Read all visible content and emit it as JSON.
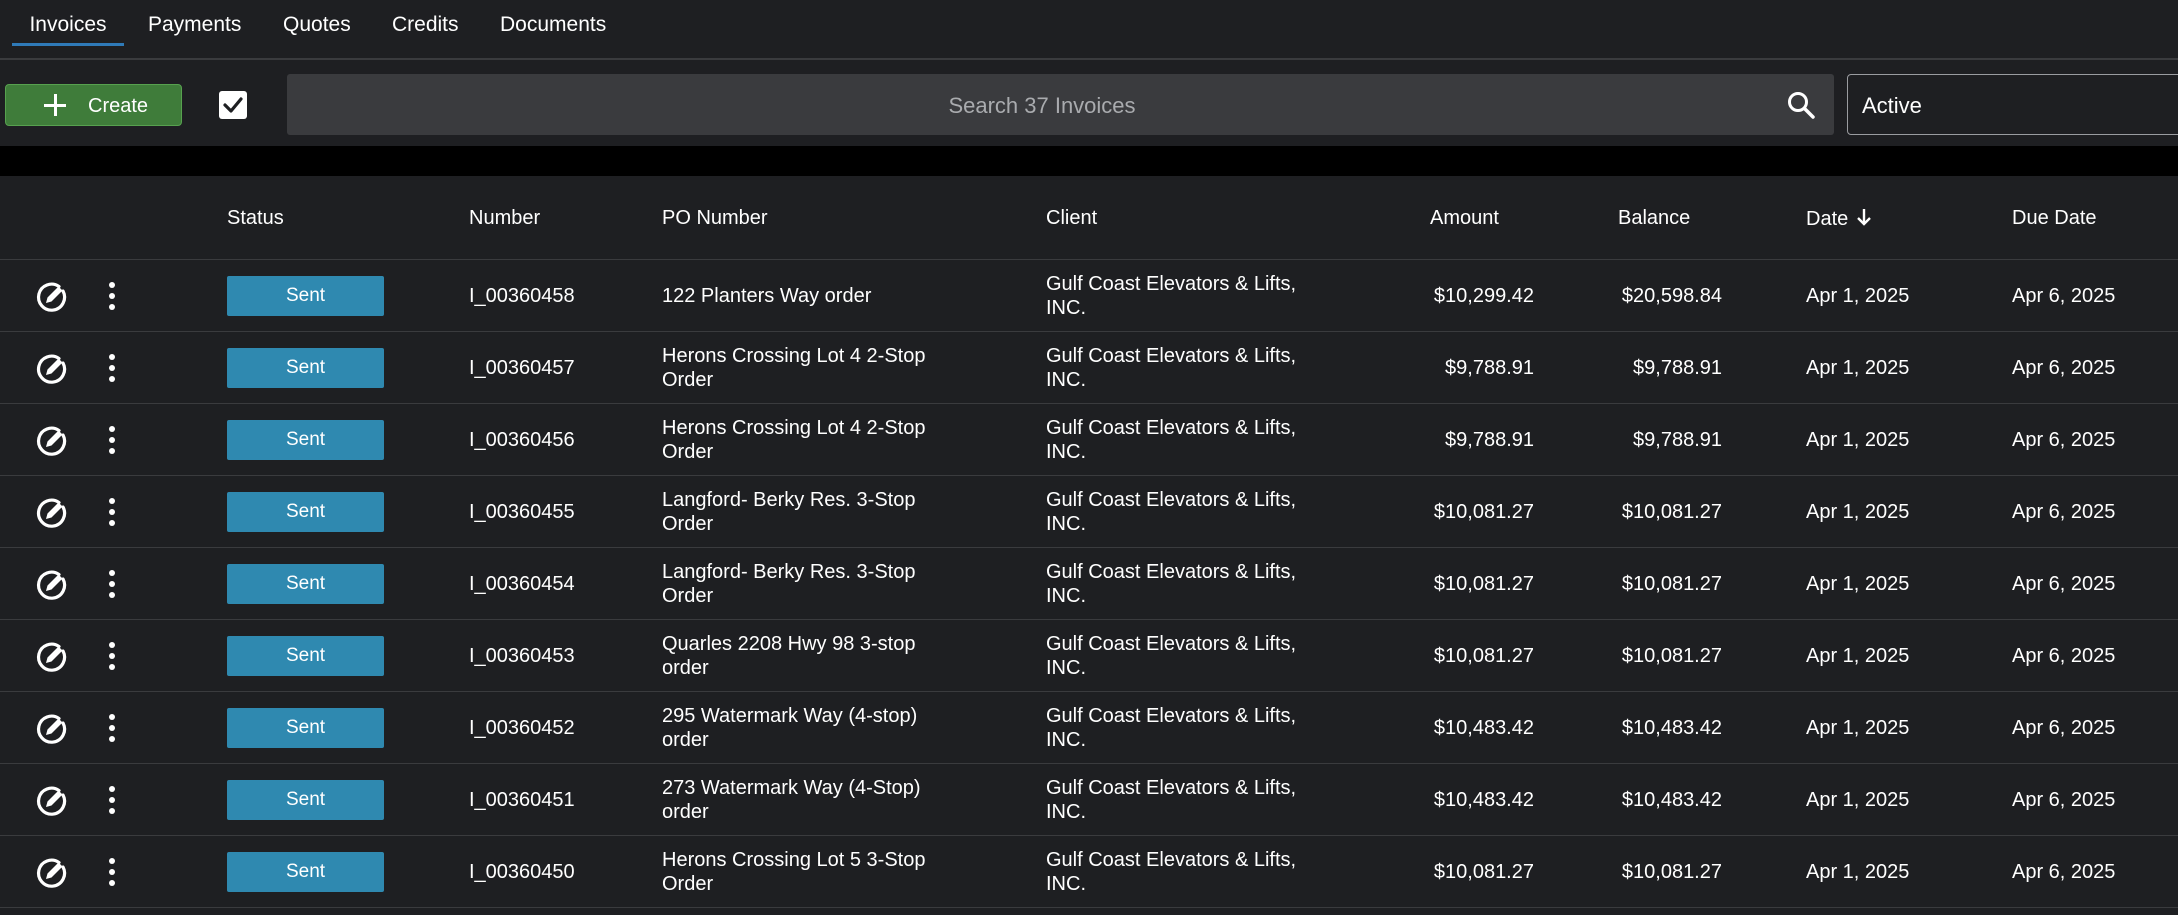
{
  "tabs": [
    {
      "label": "Invoices",
      "active": true
    },
    {
      "label": "Payments",
      "active": false
    },
    {
      "label": "Quotes",
      "active": false
    },
    {
      "label": "Credits",
      "active": false
    },
    {
      "label": "Documents",
      "active": false
    }
  ],
  "toolbar": {
    "create_label": "Create",
    "search_placeholder": "Search 37 Invoices",
    "status_filter": "Active"
  },
  "table": {
    "headers": {
      "status": "Status",
      "number": "Number",
      "po_number": "PO Number",
      "client": "Client",
      "amount": "Amount",
      "balance": "Balance",
      "date": "Date",
      "due_date": "Due Date"
    },
    "sort_indicator": "down-arrow",
    "rows": [
      {
        "status": "Sent",
        "number": "I_00360458",
        "po_line1": "122 Planters Way order",
        "po_line2": "",
        "client_line1": "Gulf Coast Elevators & Lifts,",
        "client_line2": "INC.",
        "amount": "$10,299.42",
        "balance": "$20,598.84",
        "date": "Apr 1, 2025",
        "due_date": "Apr 6, 2025"
      },
      {
        "status": "Sent",
        "number": "I_00360457",
        "po_line1": "Herons Crossing Lot 4  2-Stop",
        "po_line2": "Order",
        "client_line1": "Gulf Coast Elevators & Lifts,",
        "client_line2": "INC.",
        "amount": "$9,788.91",
        "balance": "$9,788.91",
        "date": "Apr 1, 2025",
        "due_date": "Apr 6, 2025"
      },
      {
        "status": "Sent",
        "number": "I_00360456",
        "po_line1": "Herons Crossing Lot 4  2-Stop",
        "po_line2": "Order",
        "client_line1": "Gulf Coast Elevators & Lifts,",
        "client_line2": "INC.",
        "amount": "$9,788.91",
        "balance": "$9,788.91",
        "date": "Apr 1, 2025",
        "due_date": "Apr 6, 2025"
      },
      {
        "status": "Sent",
        "number": "I_00360455",
        "po_line1": "Langford- Berky Res. 3-Stop",
        "po_line2": "Order",
        "client_line1": "Gulf Coast Elevators & Lifts,",
        "client_line2": "INC.",
        "amount": "$10,081.27",
        "balance": "$10,081.27",
        "date": "Apr 1, 2025",
        "due_date": "Apr 6, 2025"
      },
      {
        "status": "Sent",
        "number": "I_00360454",
        "po_line1": "Langford- Berky Res. 3-Stop",
        "po_line2": "Order",
        "client_line1": "Gulf Coast Elevators & Lifts,",
        "client_line2": "INC.",
        "amount": "$10,081.27",
        "balance": "$10,081.27",
        "date": "Apr 1, 2025",
        "due_date": "Apr 6, 2025"
      },
      {
        "status": "Sent",
        "number": "I_00360453",
        "po_line1": "Quarles 2208 Hwy 98 3-stop",
        "po_line2": "order",
        "client_line1": "Gulf Coast Elevators & Lifts,",
        "client_line2": "INC.",
        "amount": "$10,081.27",
        "balance": "$10,081.27",
        "date": "Apr 1, 2025",
        "due_date": "Apr 6, 2025"
      },
      {
        "status": "Sent",
        "number": "I_00360452",
        "po_line1": "295 Watermark Way (4-stop)",
        "po_line2": "order",
        "client_line1": "Gulf Coast Elevators & Lifts,",
        "client_line2": "INC.",
        "amount": "$10,483.42",
        "balance": "$10,483.42",
        "date": "Apr 1, 2025",
        "due_date": "Apr 6, 2025"
      },
      {
        "status": "Sent",
        "number": "I_00360451",
        "po_line1": "273 Watermark Way (4-Stop)",
        "po_line2": "order",
        "client_line1": "Gulf Coast Elevators & Lifts,",
        "client_line2": "INC.",
        "amount": "$10,483.42",
        "balance": "$10,483.42",
        "date": "Apr 1, 2025",
        "due_date": "Apr 6, 2025"
      },
      {
        "status": "Sent",
        "number": "I_00360450",
        "po_line1": "Herons Crossing Lot 5 3-Stop",
        "po_line2": "Order",
        "client_line1": "Gulf Coast Elevators & Lifts,",
        "client_line2": "INC.",
        "amount": "$10,081.27",
        "balance": "$10,081.27",
        "date": "Apr 1, 2025",
        "due_date": "Apr 6, 2025"
      }
    ]
  },
  "colors": {
    "background": "#1e1f22",
    "accent": "#2f7ab8",
    "status_sent": "#2f89b0",
    "create_button": "#3f7c3a"
  },
  "icons": {
    "row_edit": "edit-circle-icon",
    "row_menu": "kebab-menu-icon",
    "search": "search-icon",
    "sort": "arrow-down-icon"
  }
}
